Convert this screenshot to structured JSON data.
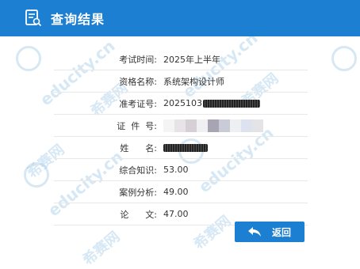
{
  "header": {
    "title": "查询结果",
    "icon": "document-search-icon",
    "bg_color": "#1c7fd1"
  },
  "result": {
    "rows": [
      {
        "label": "考试时间:",
        "value": "2025年上半年"
      },
      {
        "label": "资格名称:",
        "value": "系统架构设计师"
      },
      {
        "label": "准考证号:",
        "value": "2025103"
      },
      {
        "label": "证  件  号:",
        "value": ""
      },
      {
        "label": "姓      名:",
        "value": ""
      },
      {
        "label": "综合知识:",
        "value": "53.00"
      },
      {
        "label": "案例分析:",
        "value": "49.00"
      },
      {
        "label": "论      文:",
        "value": "47.00"
      }
    ]
  },
  "back_button": {
    "label": "返回",
    "icon": "back-arrow-icon"
  },
  "watermark": {
    "text": "educity.cn",
    "brand": "希赛网"
  }
}
